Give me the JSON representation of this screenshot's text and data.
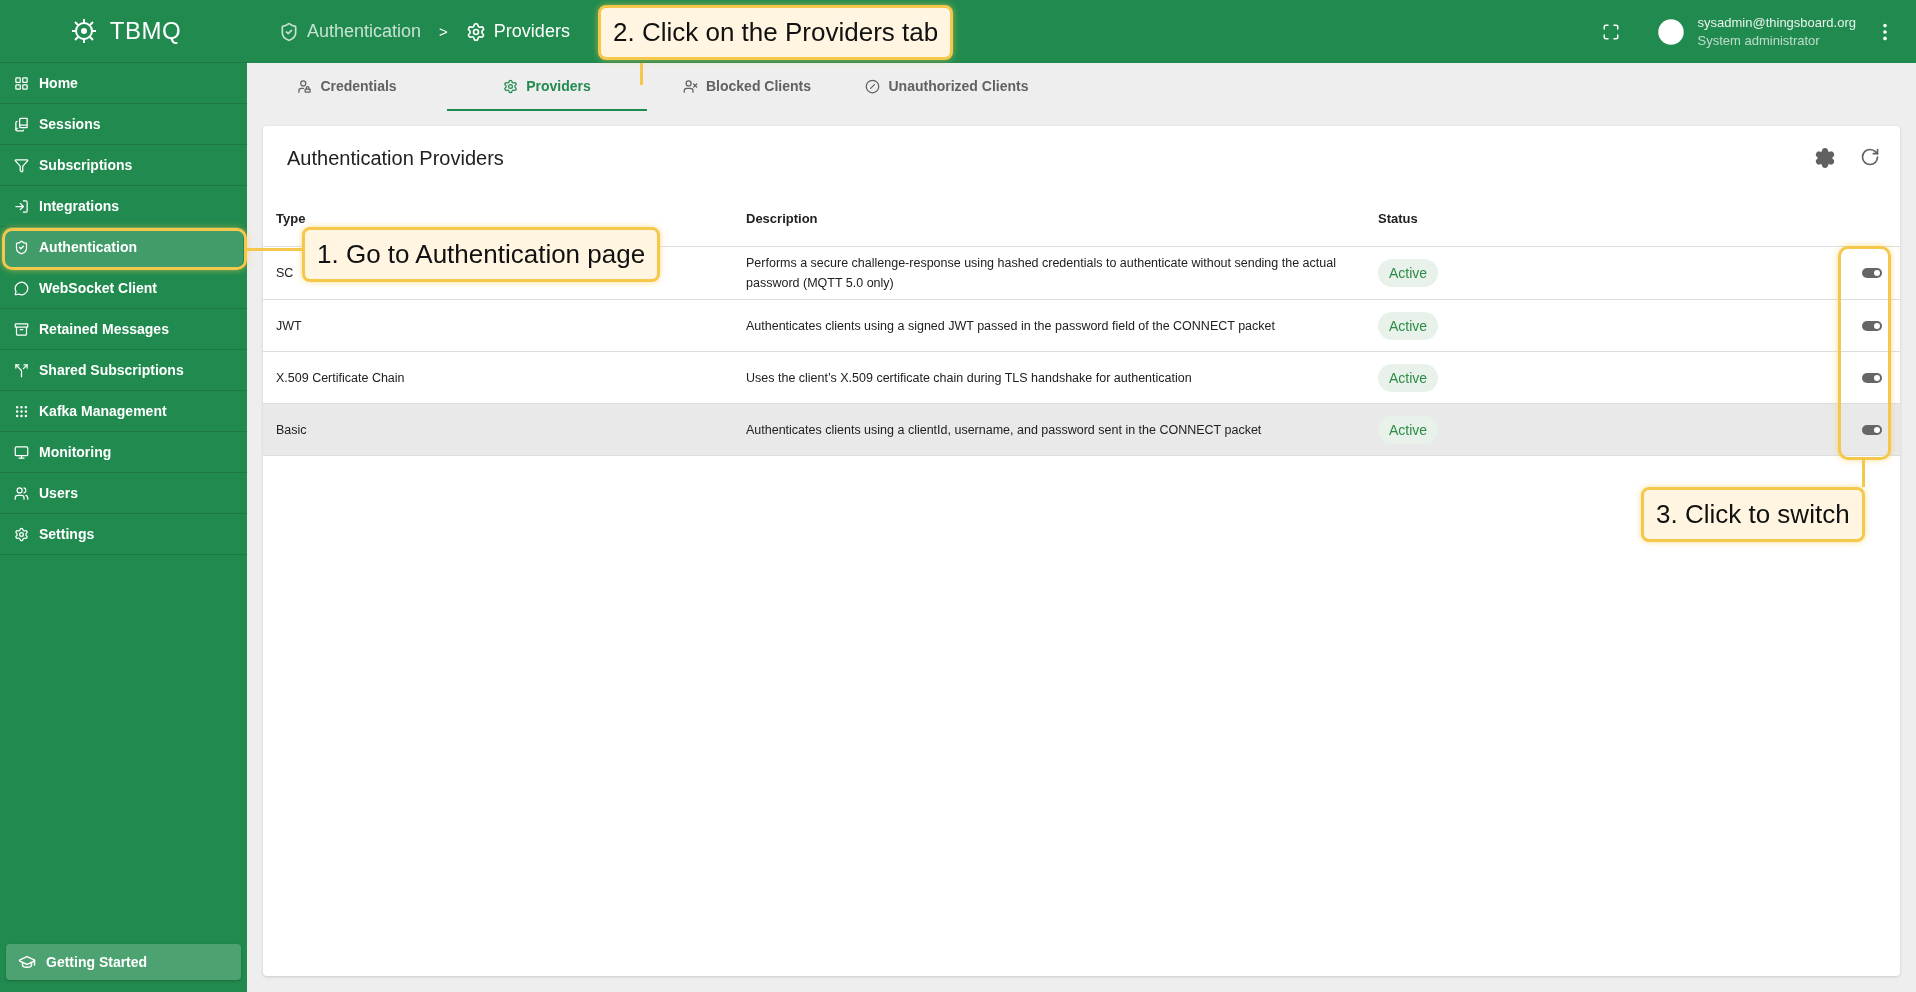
{
  "app": {
    "name": "TBMQ"
  },
  "breadcrumb": {
    "items": [
      {
        "label": "Authentication"
      },
      {
        "label": "Providers"
      }
    ],
    "separator": ">"
  },
  "user": {
    "email": "sysadmin@thingsboard.org",
    "role": "System administrator"
  },
  "sidebar": {
    "items": [
      {
        "label": "Home",
        "selected": false
      },
      {
        "label": "Sessions",
        "selected": false
      },
      {
        "label": "Subscriptions",
        "selected": false
      },
      {
        "label": "Integrations",
        "selected": false
      },
      {
        "label": "Authentication",
        "selected": true
      },
      {
        "label": "WebSocket Client",
        "selected": false
      },
      {
        "label": "Retained Messages",
        "selected": false
      },
      {
        "label": "Shared Subscriptions",
        "selected": false
      },
      {
        "label": "Kafka Management",
        "selected": false
      },
      {
        "label": "Monitoring",
        "selected": false
      },
      {
        "label": "Users",
        "selected": false
      },
      {
        "label": "Settings",
        "selected": false
      }
    ],
    "footer_button": "Getting Started"
  },
  "tabs": [
    {
      "label": "Credentials",
      "selected": false
    },
    {
      "label": "Providers",
      "selected": true
    },
    {
      "label": "Blocked Clients",
      "selected": false
    },
    {
      "label": "Unauthorized Clients",
      "selected": false
    }
  ],
  "card": {
    "title": "Authentication Providers",
    "columns": [
      "Type",
      "Description",
      "Status"
    ],
    "rows": [
      {
        "type": "SC",
        "description": "Performs a secure challenge-response using hashed credentials to authenticate without sending the actual password (MQTT 5.0 only)",
        "status": "Active",
        "enabled": true,
        "hovered": false
      },
      {
        "type": "JWT",
        "description": "Authenticates clients using a signed JWT passed in the password field of the CONNECT packet",
        "status": "Active",
        "enabled": true,
        "hovered": false
      },
      {
        "type": "X.509 Certificate Chain",
        "description": "Uses the client’s X.509 certificate chain during TLS handshake for authentication",
        "status": "Active",
        "enabled": true,
        "hovered": false
      },
      {
        "type": "Basic",
        "description": "Authenticates clients using a clientId, username, and password sent in the CONNECT packet",
        "status": "Active",
        "enabled": true,
        "hovered": true
      }
    ]
  },
  "callouts": [
    {
      "text": "1. Go to Authentication page"
    },
    {
      "text": "2. Click on the Providers tab"
    },
    {
      "text": "3. Click to switch"
    }
  ]
}
